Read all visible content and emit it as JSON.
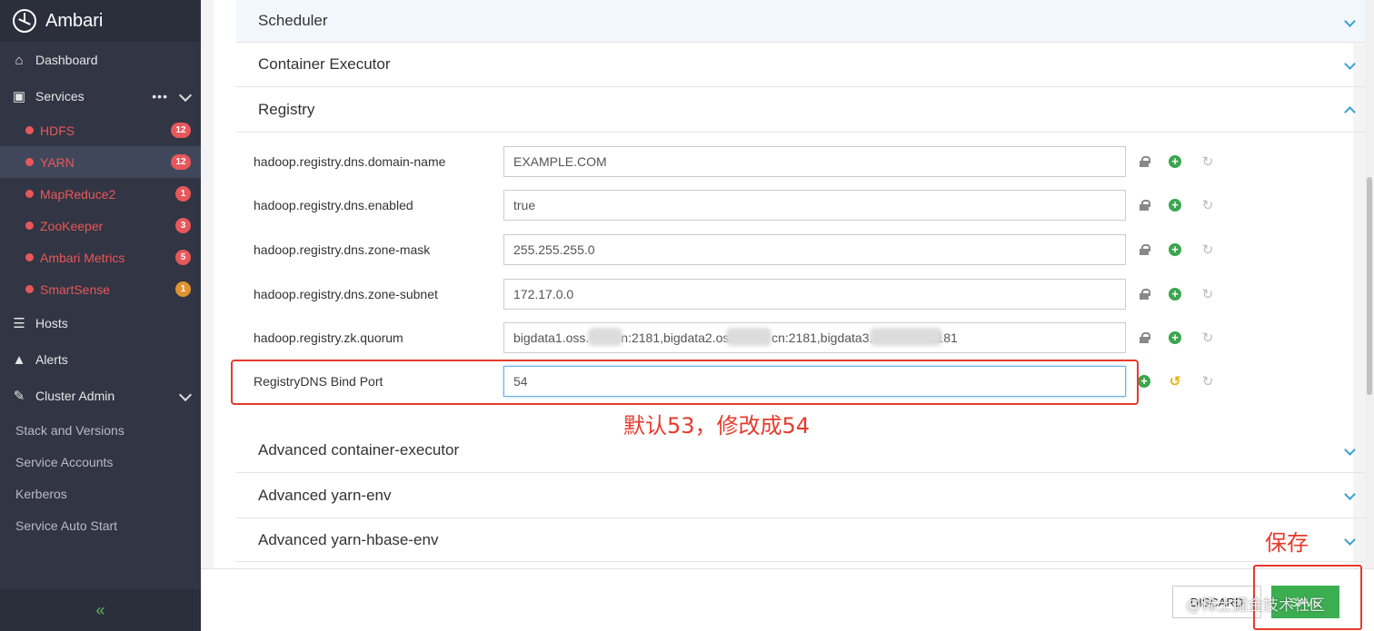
{
  "app": {
    "name": "Ambari"
  },
  "sidebar": {
    "nav": [
      {
        "label": "Dashboard"
      },
      {
        "label": "Services",
        "more": "•••"
      },
      {
        "label": "Hosts"
      },
      {
        "label": "Alerts"
      },
      {
        "label": "Cluster Admin"
      }
    ],
    "services": [
      {
        "label": "HDFS",
        "badge": "12"
      },
      {
        "label": "YARN",
        "badge": "12"
      },
      {
        "label": "MapReduce2",
        "badge": "1"
      },
      {
        "label": "ZooKeeper",
        "badge": "3"
      },
      {
        "label": "Ambari Metrics",
        "badge": "5"
      },
      {
        "label": "SmartSense",
        "badge": "1"
      }
    ],
    "admin_items": [
      {
        "label": "Stack and Versions"
      },
      {
        "label": "Service Accounts"
      },
      {
        "label": "Kerberos"
      },
      {
        "label": "Service Auto Start"
      }
    ],
    "collapse_glyph": "«"
  },
  "sections": {
    "scheduler": "Scheduler",
    "container_executor": "Container Executor",
    "registry": "Registry",
    "adv_container_executor": "Advanced container-executor",
    "adv_yarn_env": "Advanced yarn-env",
    "adv_yarn_hbase_env": "Advanced yarn-hbase-env"
  },
  "registry_props": [
    {
      "name": "hadoop.registry.dns.domain-name",
      "value": "EXAMPLE.COM"
    },
    {
      "name": "hadoop.registry.dns.enabled",
      "value": "true"
    },
    {
      "name": "hadoop.registry.dns.zone-mask",
      "value": "255.255.255.0"
    },
    {
      "name": "hadoop.registry.dns.zone-subnet",
      "value": "172.17.0.0"
    },
    {
      "name": "hadoop.registry.zk.quorum",
      "value": "bigdata1.oss.         n:2181,bigdata2.os            cn:2181,bigdata3.                2181"
    },
    {
      "name": "RegistryDNS Bind Port",
      "value": "54"
    }
  ],
  "annotations": {
    "port_note": "默认53，修改成54",
    "save_note": "保存"
  },
  "footer": {
    "discard_label": "DISCARD",
    "save_label": "SAVE",
    "watermark": "@稀土掘金技术社区"
  },
  "colors": {
    "sidebar_bg": "#323544",
    "alert_red": "#e8575a",
    "accent_green": "#3bae51",
    "annotation_red": "#e63a2d"
  }
}
